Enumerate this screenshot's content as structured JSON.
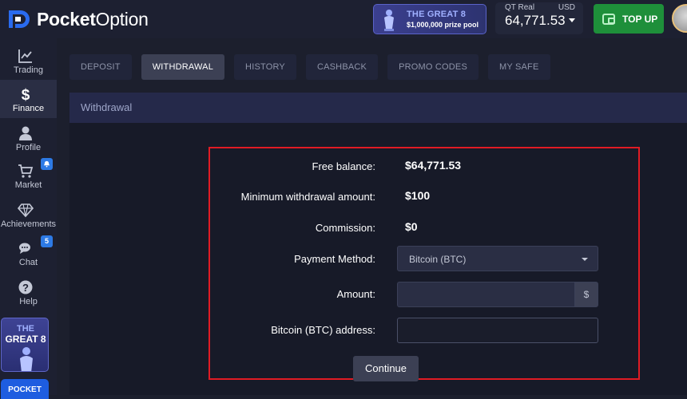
{
  "brand": {
    "name_bold": "Pocket",
    "name_light": "Option"
  },
  "promo": {
    "title": "THE GREAT 8",
    "subtitle": "$1,000,000 prize pool"
  },
  "account": {
    "type": "QT Real",
    "currency": "USD",
    "balance": "64,771.53"
  },
  "topup": {
    "label": "TOP UP"
  },
  "sidebar": {
    "items": [
      {
        "label": "Trading",
        "icon": "chart-line-icon"
      },
      {
        "label": "Finance",
        "icon": "dollar-icon",
        "active": true
      },
      {
        "label": "Profile",
        "icon": "user-icon"
      },
      {
        "label": "Market",
        "icon": "cart-icon",
        "badge": "bell"
      },
      {
        "label": "Achievements",
        "icon": "diamond-icon"
      },
      {
        "label": "Chat",
        "icon": "chat-icon",
        "badge": "5"
      },
      {
        "label": "Help",
        "icon": "question-icon"
      }
    ],
    "banner": {
      "line1": "THE",
      "line2": "GREAT 8"
    },
    "pocket_label": "POCKET"
  },
  "tabs": [
    {
      "label": "DEPOSIT"
    },
    {
      "label": "WITHDRAWAL",
      "active": true
    },
    {
      "label": "HISTORY"
    },
    {
      "label": "CASHBACK"
    },
    {
      "label": "PROMO CODES"
    },
    {
      "label": "MY SAFE"
    }
  ],
  "page": {
    "title": "Withdrawal"
  },
  "form": {
    "free_balance_label": "Free balance:",
    "free_balance_value": "$64,771.53",
    "min_withdrawal_label": "Minimum withdrawal amount:",
    "min_withdrawal_value": "$100",
    "commission_label": "Commission:",
    "commission_value": "$0",
    "payment_method_label": "Payment Method:",
    "payment_method_value": "Bitcoin (BTC)",
    "amount_label": "Amount:",
    "amount_value": "",
    "amount_suffix": "$",
    "address_label": "Bitcoin (BTC) address:",
    "address_value": "",
    "continue_label": "Continue"
  },
  "colors": {
    "accent_green": "#1e8f3a",
    "highlight_red": "#e01b24",
    "badge_blue": "#2d7ae5"
  }
}
